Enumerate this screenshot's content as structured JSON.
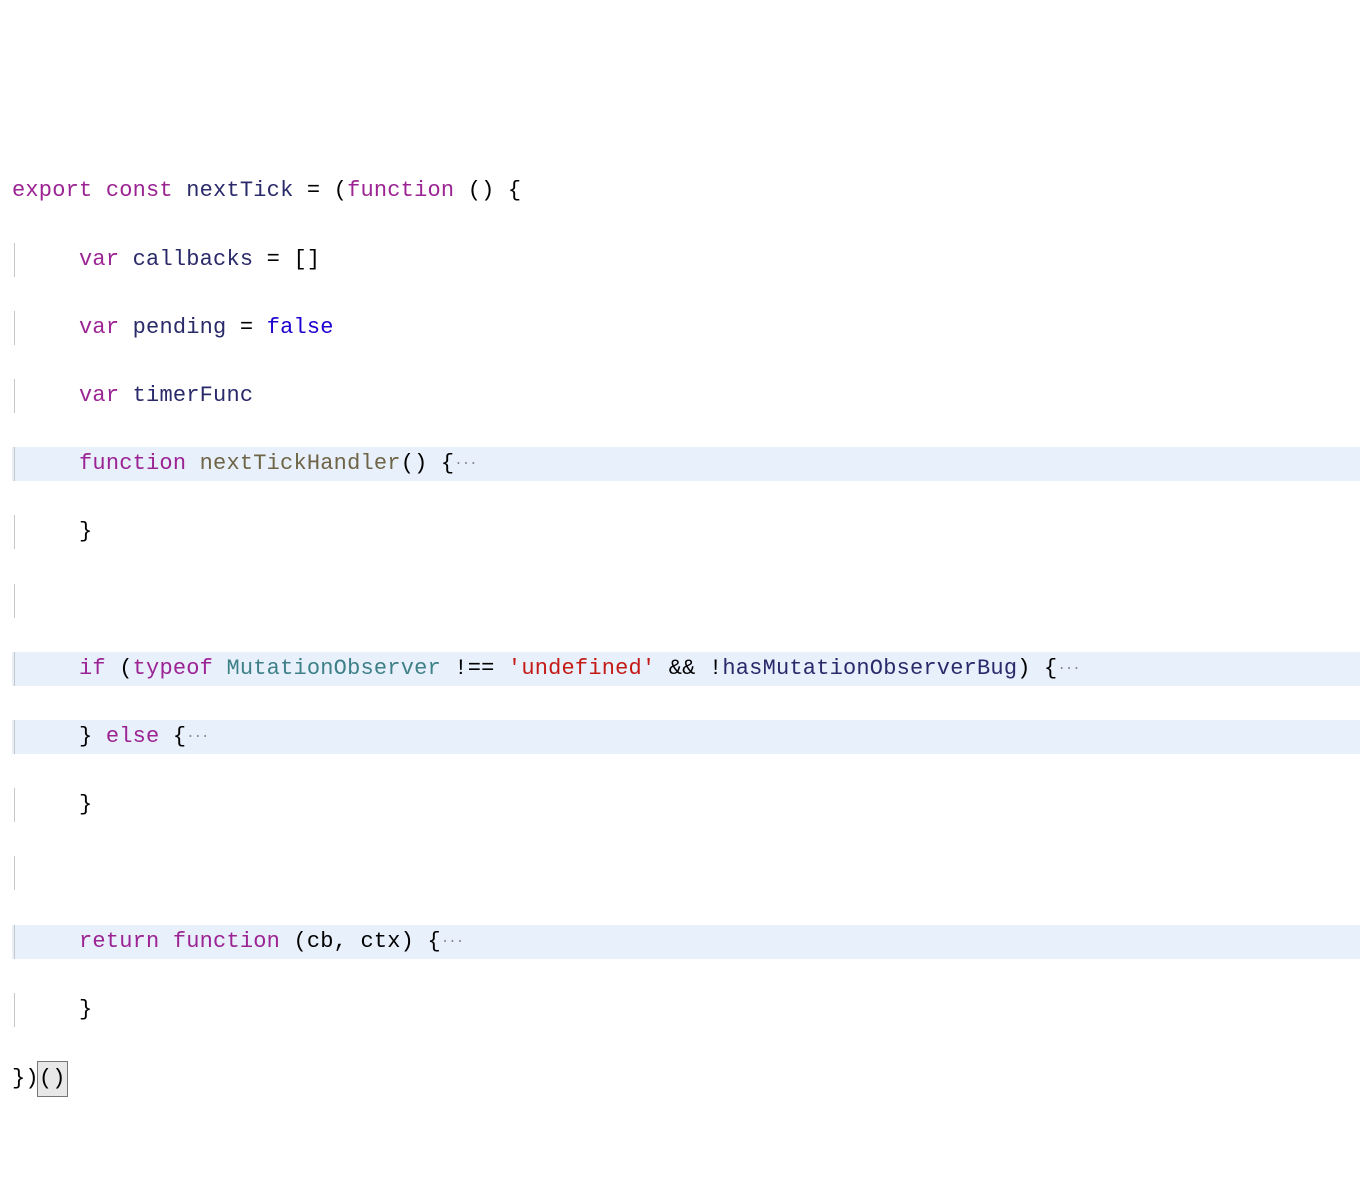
{
  "code": {
    "l1": {
      "export": "export",
      "const": "const",
      "nextTick": "nextTick",
      "eq": " = (",
      "function": "function",
      "rest": " () {"
    },
    "l2": {
      "var": "var",
      "callbacks": "callbacks",
      "rest": " = []"
    },
    "l3": {
      "var": "var",
      "pending": "pending",
      "eq": " = ",
      "false": "false"
    },
    "l4": {
      "var": "var",
      "timerFunc": "timerFunc"
    },
    "l5": {
      "function": "function",
      "name": "nextTickHandler",
      "rest": "() {",
      "fold": "···"
    },
    "l6": {
      "brace": "}"
    },
    "l8": {
      "if": "if",
      "open": " (",
      "typeof": "typeof",
      "mo": "MutationObserver",
      "neq": " !== ",
      "undef": "'undefined'",
      "and": " && !",
      "bug": "hasMutationObserverBug",
      "close": ") {",
      "fold": "···"
    },
    "l9": {
      "closebrace": "} ",
      "else": "else",
      "open": " {",
      "fold": "···"
    },
    "l10": {
      "brace": "}"
    },
    "l12": {
      "return": "return",
      "sp": " ",
      "function": "function",
      "params": " (cb, ctx) {",
      "fold": "···"
    },
    "l13": {
      "brace": "}"
    },
    "l14": {
      "close": "})",
      "call": "()"
    }
  }
}
